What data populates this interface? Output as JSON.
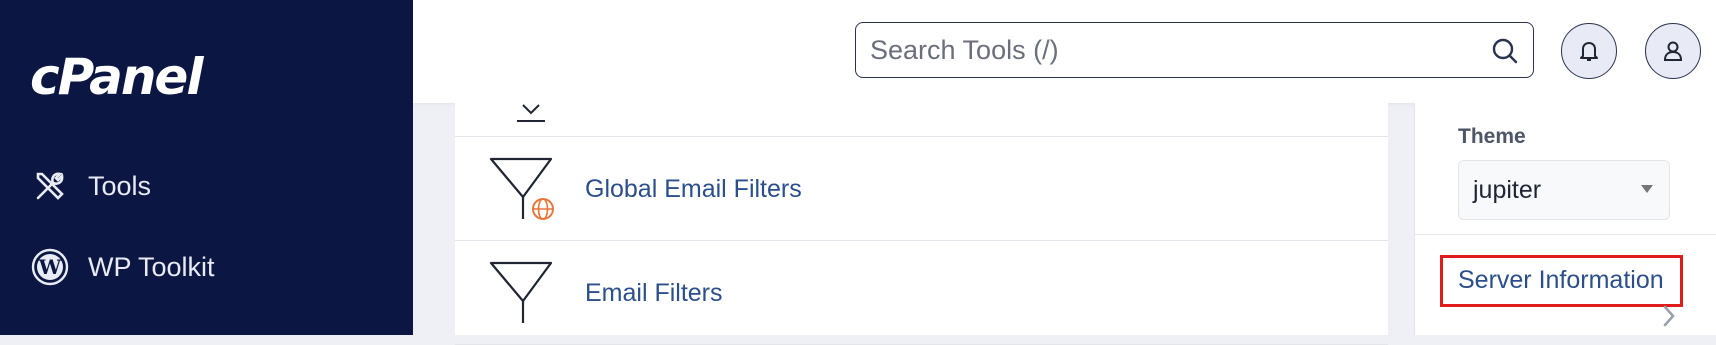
{
  "sidebar": {
    "logo_text": "cPanel",
    "items": [
      {
        "label": "Tools",
        "icon": "tools-icon"
      },
      {
        "label": "WP Toolkit",
        "icon": "wordpress-icon"
      }
    ]
  },
  "header": {
    "search": {
      "placeholder": "Search Tools (/)",
      "value": ""
    },
    "icons": [
      "bell-icon",
      "user-icon"
    ]
  },
  "main": {
    "rows": [
      {
        "label": "Global Email Filters",
        "icon": "global-filter-icon"
      },
      {
        "label": "Email Filters",
        "icon": "filter-icon"
      }
    ]
  },
  "rpanel": {
    "theme_label": "Theme",
    "theme_value": "jupiter",
    "server_info_label": "Server Information"
  },
  "colors": {
    "sidebar_bg": "#0b1742",
    "link": "#2c4f8c",
    "accent_orange": "#e8763a",
    "highlight_red": "#e01b1b"
  }
}
